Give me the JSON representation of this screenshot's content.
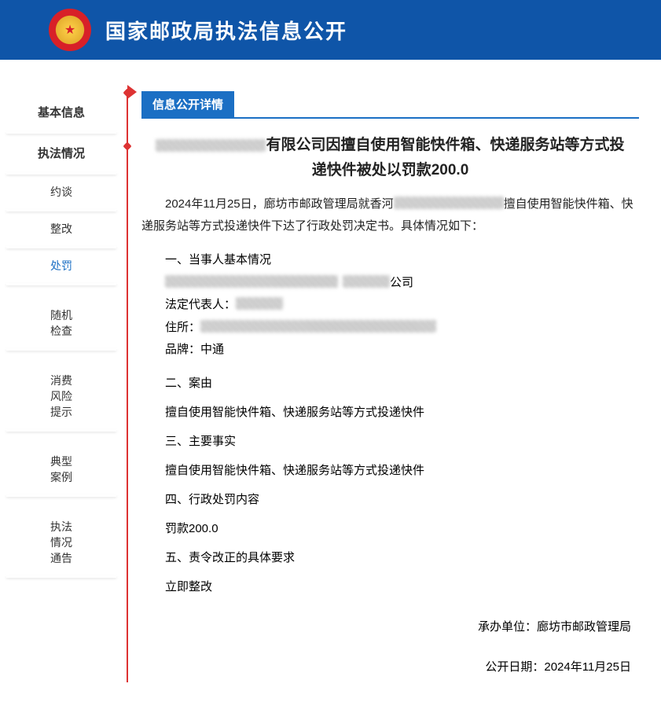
{
  "header": {
    "title": "国家邮政局执法信息公开"
  },
  "sidebar": {
    "items": [
      {
        "label": "基本信息",
        "type": "top"
      },
      {
        "label": "执法情况",
        "type": "top"
      },
      {
        "label": "约谈",
        "type": "sub"
      },
      {
        "label": "整改",
        "type": "sub"
      },
      {
        "label": "处罚",
        "type": "sub",
        "active": true
      },
      {
        "label": "随机\n检查",
        "type": "sub"
      },
      {
        "label": "消费\n风险\n提示",
        "type": "sub"
      },
      {
        "label": "典型\n案例",
        "type": "sub"
      },
      {
        "label": "执法\n情况\n通告",
        "type": "sub"
      }
    ]
  },
  "detail": {
    "tag": "信息公开详情",
    "title_suffix": "有限公司因擅自使用智能快件箱、快递服务站等方式投递快件被处以罚款200.0",
    "intro_prefix": "2024年11月25日，廊坊市邮政管理局就香河",
    "intro_suffix": "擅自使用智能快件箱、快递服务站等方式投递快件下达了行政处罚决定书。具体情况如下：",
    "sections": {
      "s1": "一、当事人基本情况",
      "party_suffix": "公司",
      "legal_rep_label": "法定代表人：",
      "address_label": "住所：",
      "brand_label": "品牌：",
      "brand_value": "中通",
      "s2": "二、案由",
      "cause": "擅自使用智能快件箱、快递服务站等方式投递快件",
      "s3": "三、主要事实",
      "facts": "擅自使用智能快件箱、快递服务站等方式投递快件",
      "s4": "四、行政处罚内容",
      "penalty": "罚款200.0",
      "s5": "五、责令改正的具体要求",
      "rectify": "立即整改"
    },
    "footer": {
      "handler_label": "承办单位：",
      "handler_value": "廊坊市邮政管理局",
      "date_label": "公开日期：",
      "date_value": "2024年11月25日"
    }
  }
}
